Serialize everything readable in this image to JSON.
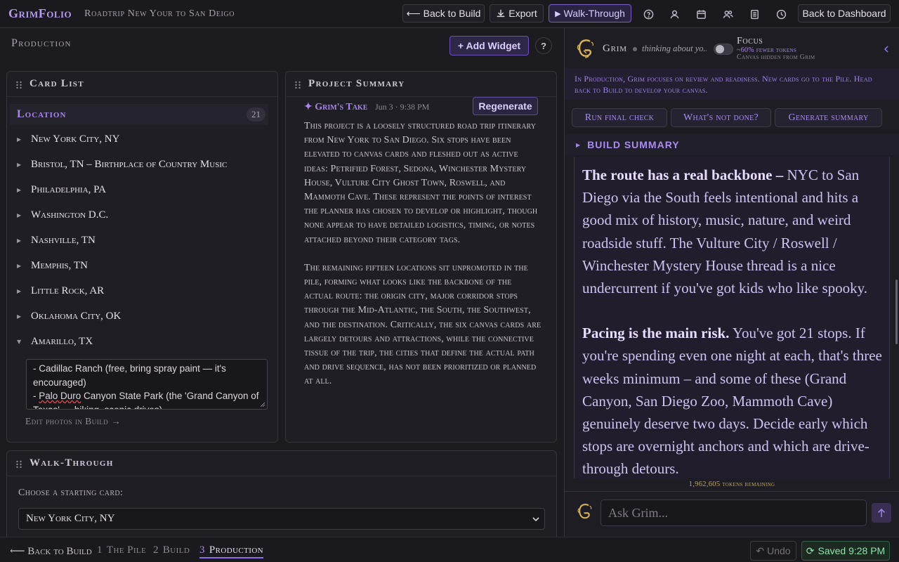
{
  "app": {
    "brand": "GrimFolio",
    "project_title": "Roadtrip New Your to San Deigo"
  },
  "topbar": {
    "back_to_build": "Back to Build",
    "export": "Export",
    "walkthrough": "Walk-Through",
    "back_to_dashboard": "Back to Dashboard",
    "icons": [
      "help-icon",
      "user-icon",
      "calendar-icon",
      "users-icon",
      "document-icon",
      "clock-icon"
    ]
  },
  "production": {
    "title": "Production",
    "add_widget": "+ Add Widget",
    "help": "?"
  },
  "card_list": {
    "title": "Card List",
    "group": {
      "title": "Location",
      "count": "21"
    },
    "items": [
      {
        "label": "New York City, NY",
        "expanded": false
      },
      {
        "label": "Bristol, TN – Birthplace of Country Music",
        "expanded": false
      },
      {
        "label": "Philadelphia, PA",
        "expanded": false
      },
      {
        "label": "Washington D.C.",
        "expanded": false
      },
      {
        "label": "Nashville, TN",
        "expanded": false
      },
      {
        "label": "Memphis, TN",
        "expanded": false
      },
      {
        "label": "Little Rock, AR",
        "expanded": false
      },
      {
        "label": "Oklahoma City, OK",
        "expanded": false
      },
      {
        "label": "Amarillo, TX",
        "expanded": true
      }
    ],
    "notes": {
      "line1": "- Cadillac Ranch (free, bring spray paint — it's encouraged)",
      "line2_pre": "- ",
      "line2_squig": "Palo Duro",
      "line2_post": " Canyon State Park (the 'Grand Canyon of Texas' — hiking, scenic drives)"
    },
    "edit_photos": "Edit photos in Build →"
  },
  "project_summary": {
    "title": "Project Summary",
    "grims_take": "✦ Grim's Take",
    "date": "Jun 3 · 9:38 PM",
    "regenerate": "Regenerate",
    "paragraphs": [
      "This project is a loosely structured road trip itinerary from New York to San Diego. Six stops have been elevated to canvas cards and fleshed out as active ideas: Petrified Forest, Sedona, Winchester Mystery House, Vulture City Ghost Town, Roswell, and Mammoth Cave. These represent the points of interest the planner has chosen to develop or highlight, though none appear to have detailed logistics, timing, or notes attached beyond their category tags.",
      "The remaining fifteen locations sit unpromoted in the pile, forming what looks like the backbone of the actual route: the origin city, major corridor stops through the Mid-Atlantic, the South, the Southwest, and the destination. Critically, the six canvas cards are largely detours and attractions, while the connective tissue of the trip, the cities that define the actual path and drive sequence, has not been prioritized or planned at all."
    ]
  },
  "walkthrough": {
    "title": "Walk-Through",
    "choose_label": "Choose a starting card:",
    "selected": "New York City, NY"
  },
  "bottombar": {
    "back_to_build": "⟵ Back to Build",
    "steps": [
      {
        "num": "1",
        "label": "The Pile",
        "active": false
      },
      {
        "num": "2",
        "label": "Build",
        "active": false
      },
      {
        "num": "3",
        "label": "Production",
        "active": true
      }
    ],
    "undo": "Undo",
    "saved": "Saved 9:28 PM"
  },
  "sidebar": {
    "name": "Grim",
    "thinking": "thinking about yo...",
    "focus_title": "Focus",
    "focus_sub1": "~60% fewer tokens",
    "focus_sub2": "Canvas hidden from Grim",
    "focus_enabled": false,
    "info": "In Production, Grim focuses on review and readiness. New cards go to the Pile. Head back to Build to develop your canvas.",
    "chips": [
      "Run final check",
      "What's not done?",
      "Generate summary"
    ],
    "build_summary": "BUILD SUMMARY",
    "message": {
      "p1_bold": "The route has a real backbone –",
      "p1_rest": " NYC to San Diego via the South feels intentional and hits a good mix of history, music, nature, and weird roadside stuff. The Vulture City / Roswell / Winchester Mystery House thread is a nice undercurrent if you've got kids who like spooky.",
      "p2_bold": "Pacing is the main risk.",
      "p2_rest": " You've got 21 stops. If you're spending even one night at each, that's three weeks minimum – and some of these (Grand Canyon, San Diego Zoo, Mammoth Cave) genuinely deserve two days. Decide early which stops are overnight anchors and which are drive-through detours."
    },
    "tokens_remaining": "1,962,605 tokens remaining",
    "ask_placeholder": "Ask Grim..."
  },
  "colors": {
    "accent": "#a987f2",
    "saved_green": "#8ee2ab",
    "tokens_gold": "#c4a64a",
    "background": "#1c1b20"
  }
}
